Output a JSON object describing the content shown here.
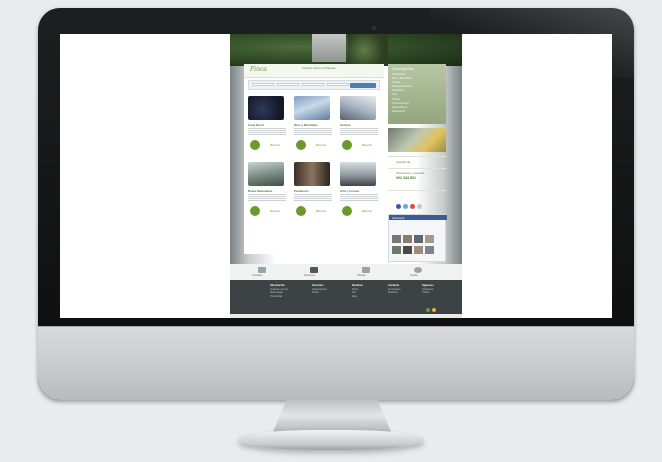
{
  "page": {
    "background": "#e9ebec"
  },
  "monitor": {
    "frame_color": "#111213",
    "chin_color": "#cfd0d2"
  },
  "website": {
    "logo": "Finca",
    "tagline": "Turismo rural en el Paraíso",
    "search": {
      "field_labels": [
        "Provincia",
        "Tipo",
        "Comarca",
        "Fecha"
      ],
      "button_label": "Buscar"
    },
    "listings": [
      {
        "title": "Casa Rural",
        "more": "Más info"
      },
      {
        "title": "Ríos y Montañas",
        "more": "Más info"
      },
      {
        "title": "Cultura",
        "more": "Más info"
      },
      {
        "title": "Rutas Naturaleza",
        "more": "Más info"
      },
      {
        "title": "Paradores",
        "more": "Más info"
      },
      {
        "title": "Arte y Costas",
        "more": "Más info"
      }
    ],
    "sidebar": {
      "category_title": "Categorías",
      "categories": [
        "Casa Rural",
        "Ríos y Montañas",
        "Cultura",
        "Rutas Naturaleza",
        "Paradores",
        "Arte",
        "Costas",
        "Turismo activo",
        "Gastronomía",
        "Ecoturismo"
      ],
      "phone": "902 334 501",
      "phone_label": "Información y reservas",
      "facebook_label": "Facebook"
    },
    "footer_icons": [
      "Contacto",
      "Reservas",
      "Ofertas",
      "Ayuda"
    ],
    "footer_columns": [
      {
        "heading": "Información",
        "lines": [
          "Quiénes somos",
          "Aviso legal",
          "Privacidad"
        ]
      },
      {
        "heading": "Servicios",
        "lines": [
          "Alojamientos",
          "Rutas"
        ]
      },
      {
        "heading": "Destinos",
        "lines": [
          "Norte",
          "Sur",
          "Este"
        ]
      },
      {
        "heading": "Contacto",
        "lines": [
          "Formulario",
          "Teléfono"
        ]
      },
      {
        "heading": "Síguenos",
        "lines": [
          "Facebook",
          "Twitter"
        ]
      }
    ]
  }
}
